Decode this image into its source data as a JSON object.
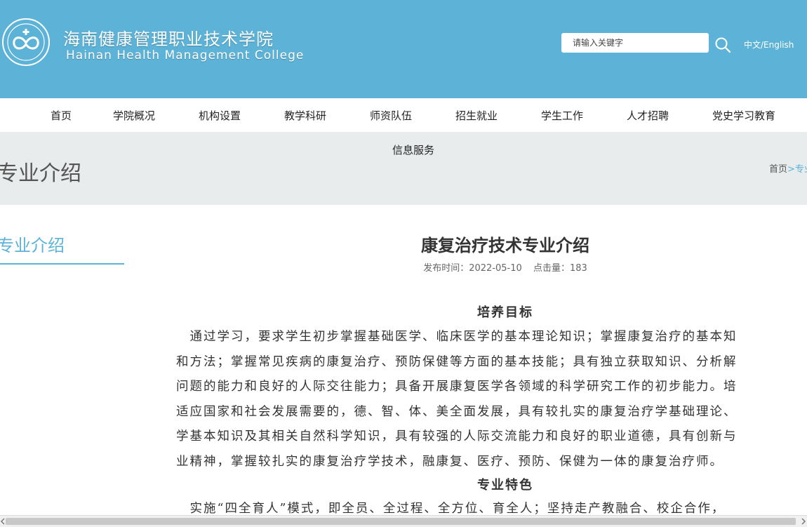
{
  "header": {
    "college_name_cn": "海南健康管理职业技术学院",
    "college_name_en": "Hainan  Health  Management  College",
    "search": {
      "placeholder": "请输入关键字"
    },
    "lang_switch": "中文/English"
  },
  "nav": {
    "items": [
      "首页",
      "学院概况",
      "机构设置",
      "教学科研",
      "师资队伍",
      "招生就业",
      "学生工作",
      "人才招聘",
      "党史学习教育",
      "信息服务"
    ]
  },
  "banner": {
    "title": "专业介绍",
    "breadcrumb": {
      "home": "首页",
      "sep": ">",
      "current": "专业介绍"
    }
  },
  "sidebar": {
    "title": "专业介绍"
  },
  "article": {
    "title": "康复治疗技术专业介绍",
    "publish_label": "发布时间：2022-05-10",
    "views_label": "点击量：183",
    "section1_title": "培养目标",
    "section1_lines": [
      "　通过学习，要求学生初步掌握基础医学、临床医学的基本理论知识；掌握康复治疗的基本知",
      "和方法；掌握常见疾病的康复治疗、预防保健等方面的基本技能；具有独立获取知识、分析解",
      "问题的能力和良好的人际交往能力；具备开展康复医学各领域的科学研究工作的初步能力。培",
      "适应国家和社会发展需要的，德、智、体、美全面发展，具有较扎实的康复治疗学基础理论、",
      "学基本知识及其相关自然科学知识，具有较强的人际交流能力和良好的职业道德，具有创新与",
      "业精神，掌握较扎实的康复治疗学技术，融康复、医疗、预防、保健为一体的康复治疗师。"
    ],
    "section2_title": "专业特色",
    "section2_lines": [
      "　实施“四全育人”模式，即全员、全过程、全方位、育全人；坚持走产教融合、校企合作，"
    ]
  },
  "colors": {
    "accent": "#5db3d7",
    "header_bg": "#5db3d7",
    "banner_bg": "#e9eced"
  }
}
